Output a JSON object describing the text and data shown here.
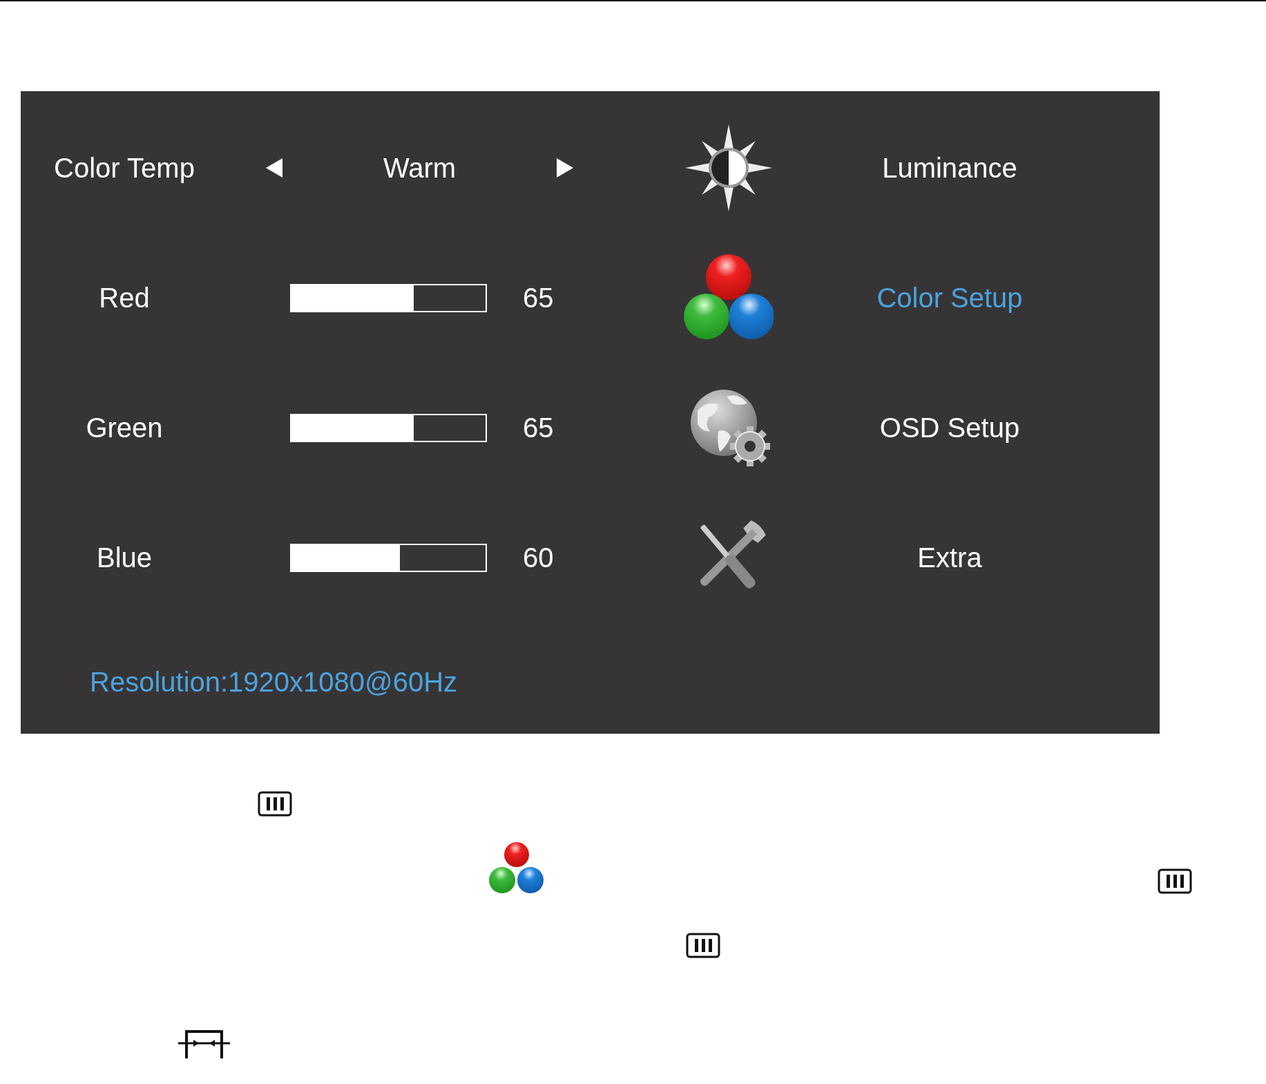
{
  "settings": [
    {
      "kind": "selector",
      "label": "Color Temp",
      "value": "Warm"
    },
    {
      "kind": "slider",
      "label": "Red",
      "level": 0.63,
      "reading": "65"
    },
    {
      "kind": "slider",
      "label": "Green",
      "level": 0.63,
      "reading": "65"
    },
    {
      "kind": "slider",
      "label": "Blue",
      "level": 0.56,
      "reading": "60"
    }
  ],
  "menu": [
    {
      "label": "Luminance",
      "selected": false
    },
    {
      "label": "Color Setup",
      "selected": true
    },
    {
      "label": "OSD Setup",
      "selected": false
    },
    {
      "label": "Extra",
      "selected": false
    }
  ],
  "footer": {
    "resolution": "Resolution:1920x1080@60Hz"
  }
}
